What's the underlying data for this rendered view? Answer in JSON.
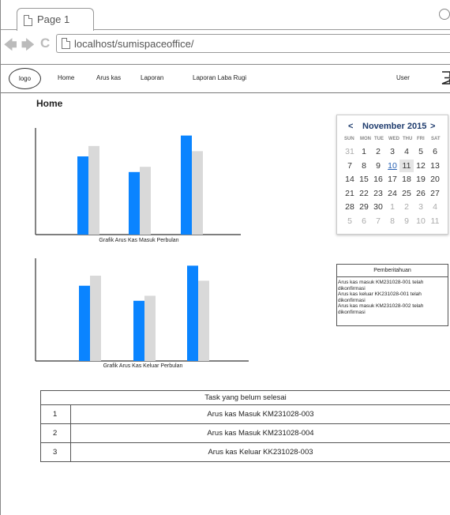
{
  "browser": {
    "tab_title": "Page 1",
    "url": "localhost/sumispaceoffice/"
  },
  "navbar": {
    "logo": "logo",
    "items": [
      "Home",
      "Arus kas",
      "Laporan",
      "Laporan Laba Rugi"
    ],
    "user": "User"
  },
  "page_title": "Home",
  "charts": {
    "masuk_caption": "Grafik Arus Kas Masuk Perbulan",
    "keluar_caption": "Grafik Arus Kas Keluar Perbulan"
  },
  "chart_data": [
    {
      "type": "bar",
      "title": "Grafik Arus Kas Masuk Perbulan",
      "categories": [
        "",
        "",
        ""
      ],
      "series": [
        {
          "color": "#0a84ff",
          "values": [
            75,
            60,
            95
          ]
        },
        {
          "color": "#d9d9d9",
          "values": [
            85,
            65,
            80
          ]
        }
      ],
      "ylim": [
        0,
        100
      ],
      "grid": false
    },
    {
      "type": "bar",
      "title": "Grafik Arus Kas Keluar Perbulan",
      "categories": [
        "",
        "",
        ""
      ],
      "series": [
        {
          "color": "#0a84ff",
          "values": [
            75,
            60,
            95
          ]
        },
        {
          "color": "#d9d9d9",
          "values": [
            85,
            65,
            80
          ]
        }
      ],
      "ylim": [
        0,
        100
      ],
      "grid": false
    }
  ],
  "calendar": {
    "prev": "<",
    "next": ">",
    "month": "November 2015",
    "weekdays": [
      "SUN",
      "MON",
      "TUE",
      "WED",
      "THU",
      "FRI",
      "SAT"
    ],
    "weeks": [
      [
        "31",
        "1",
        "2",
        "3",
        "4",
        "5",
        "6"
      ],
      [
        "7",
        "8",
        "9",
        "10",
        "11",
        "12",
        "13"
      ],
      [
        "14",
        "15",
        "16",
        "17",
        "18",
        "19",
        "20"
      ],
      [
        "21",
        "22",
        "23",
        "24",
        "25",
        "26",
        "27"
      ],
      [
        "28",
        "29",
        "30",
        "1",
        "2",
        "3",
        "4"
      ],
      [
        "5",
        "6",
        "7",
        "8",
        "9",
        "10",
        "11"
      ]
    ],
    "today": "10",
    "selected": "11"
  },
  "notifications": {
    "title": "Pemberitahuan",
    "items": [
      "Arus kas masuk KM231028-001 telah dikonfirmasi",
      "Arus kas keluar KK231028-001 telah dikonfirmasi",
      "Arus kas masuk KM231028-002 telah dikonfirmasi"
    ]
  },
  "tasks": {
    "title": "Task yang belum selesai",
    "rows": [
      {
        "no": "1",
        "label": "Arus kas Masuk KM231028-003"
      },
      {
        "no": "2",
        "label": "Arus kas Masuk KM231028-004"
      },
      {
        "no": "3",
        "label": "Arus kas Keluar KK231028-003"
      }
    ]
  }
}
